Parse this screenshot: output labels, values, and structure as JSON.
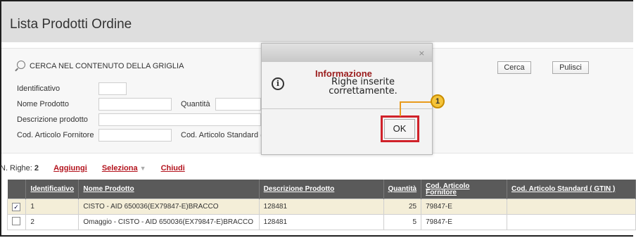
{
  "page": {
    "title": "Lista Prodotti Ordine"
  },
  "search": {
    "heading": "CERCA NEL CONTENUTO DELLA GRIGLIA",
    "fields": {
      "identificativo": "Identificativo",
      "nome_prodotto": "Nome Prodotto",
      "quantita": "Quantità",
      "descrizione": "Descrizione prodotto",
      "cod_fornitore": "Cod. Articolo Fornitore",
      "cod_standard": "Cod. Articolo Standard ( G"
    },
    "search_button": "Cerca",
    "clear_button": "Pulisci"
  },
  "toolbar": {
    "rows_label": "N. Righe:",
    "rows_count": "2",
    "add": "Aggiungi",
    "select": "Seleziona",
    "close": "Chiudi"
  },
  "grid": {
    "columns": [
      "Identificativo",
      "Nome Prodotto",
      "Descrizione Prodotto",
      "Quantità",
      "Cod. Articolo Fornitore",
      "Cod. Articolo Standard ( GTIN )"
    ],
    "rows": [
      {
        "checked": true,
        "id": "1",
        "name": "CISTO - AID 650036(EX79847-E)BRACCO",
        "description": "128481",
        "quantity": "25",
        "supplier_code": "79847-E",
        "gtin": ""
      },
      {
        "checked": false,
        "id": "2",
        "name": "Omaggio - CISTO - AID 650036(EX79847-E)BRACCO",
        "description": "128481",
        "quantity": "5",
        "supplier_code": "79847-E",
        "gtin": ""
      }
    ]
  },
  "modal": {
    "close_glyph": "×",
    "title": "Informazione",
    "message_line1": "Righe inserite",
    "message_line2": "correttamente.",
    "ok_label": "OK"
  },
  "callout": {
    "number": "1"
  },
  "icons": {
    "search": "search-icon",
    "info": "info-icon",
    "check": "✓",
    "dropdown": "▼"
  },
  "colors": {
    "link": "#b4141e",
    "header_bg": "#5a5a5a",
    "selected_row": "#f4eed8",
    "highlight": "#d0222a",
    "callout": "#f5c43a"
  }
}
